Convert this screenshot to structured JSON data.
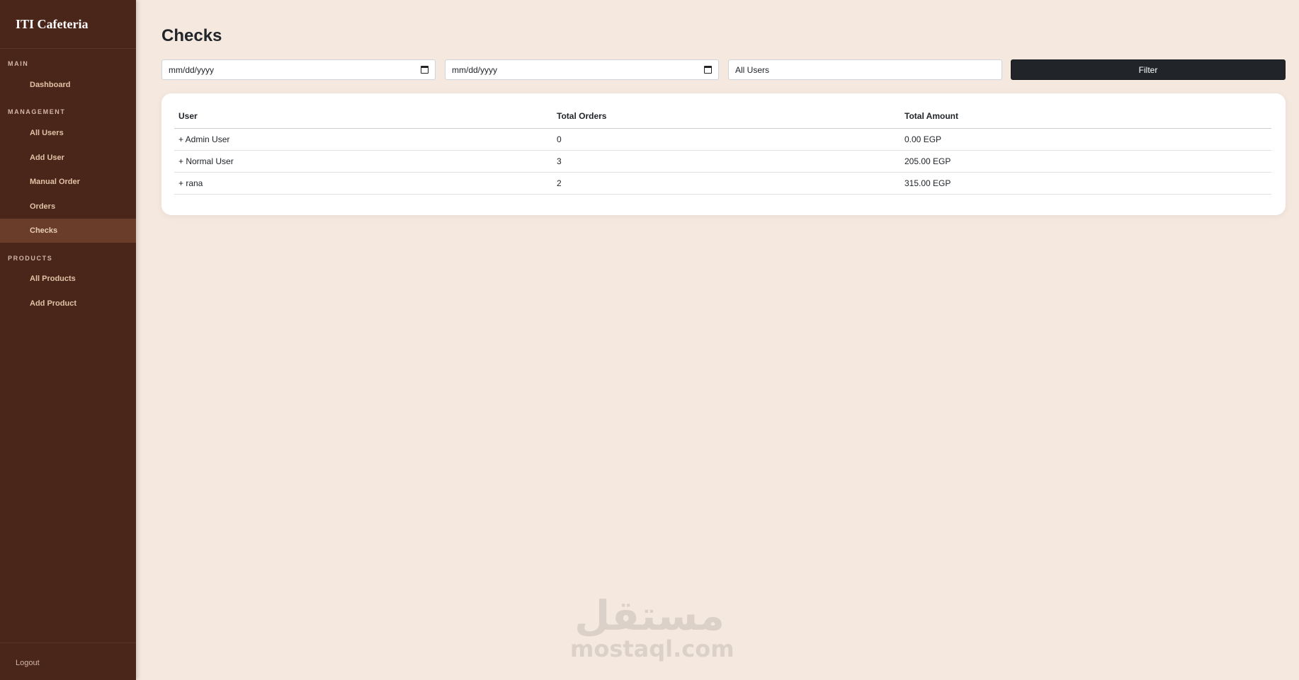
{
  "sidebar": {
    "brand": "ITI Cafeteria",
    "sections": [
      {
        "title": "MAIN",
        "items": [
          {
            "label": "Dashboard"
          }
        ]
      },
      {
        "title": "MANAGEMENT",
        "items": [
          {
            "label": "All Users"
          },
          {
            "label": "Add User"
          },
          {
            "label": "Manual Order"
          },
          {
            "label": "Orders"
          },
          {
            "label": "Checks",
            "active": true
          }
        ]
      },
      {
        "title": "PRODUCTS",
        "items": [
          {
            "label": "All Products"
          },
          {
            "label": "Add Product"
          }
        ]
      }
    ],
    "logout": "Logout"
  },
  "main": {
    "title": "Checks",
    "filters": {
      "date_from_placeholder": "mm/dd/yyyy",
      "date_to_placeholder": "mm/dd/yyyy",
      "user_select_value": "All Users",
      "filter_label": "Filter"
    },
    "table": {
      "headers": [
        "User",
        "Total Orders",
        "Total Amount"
      ],
      "rows": [
        {
          "user": "+ Admin User",
          "orders": "0",
          "amount": "0.00 EGP"
        },
        {
          "user": "+ Normal User",
          "orders": "3",
          "amount": "205.00 EGP"
        },
        {
          "user": "+ rana",
          "orders": "2",
          "amount": "315.00 EGP"
        }
      ]
    }
  },
  "watermark": {
    "arabic": "مستقل",
    "latin": "mostaql.com"
  }
}
